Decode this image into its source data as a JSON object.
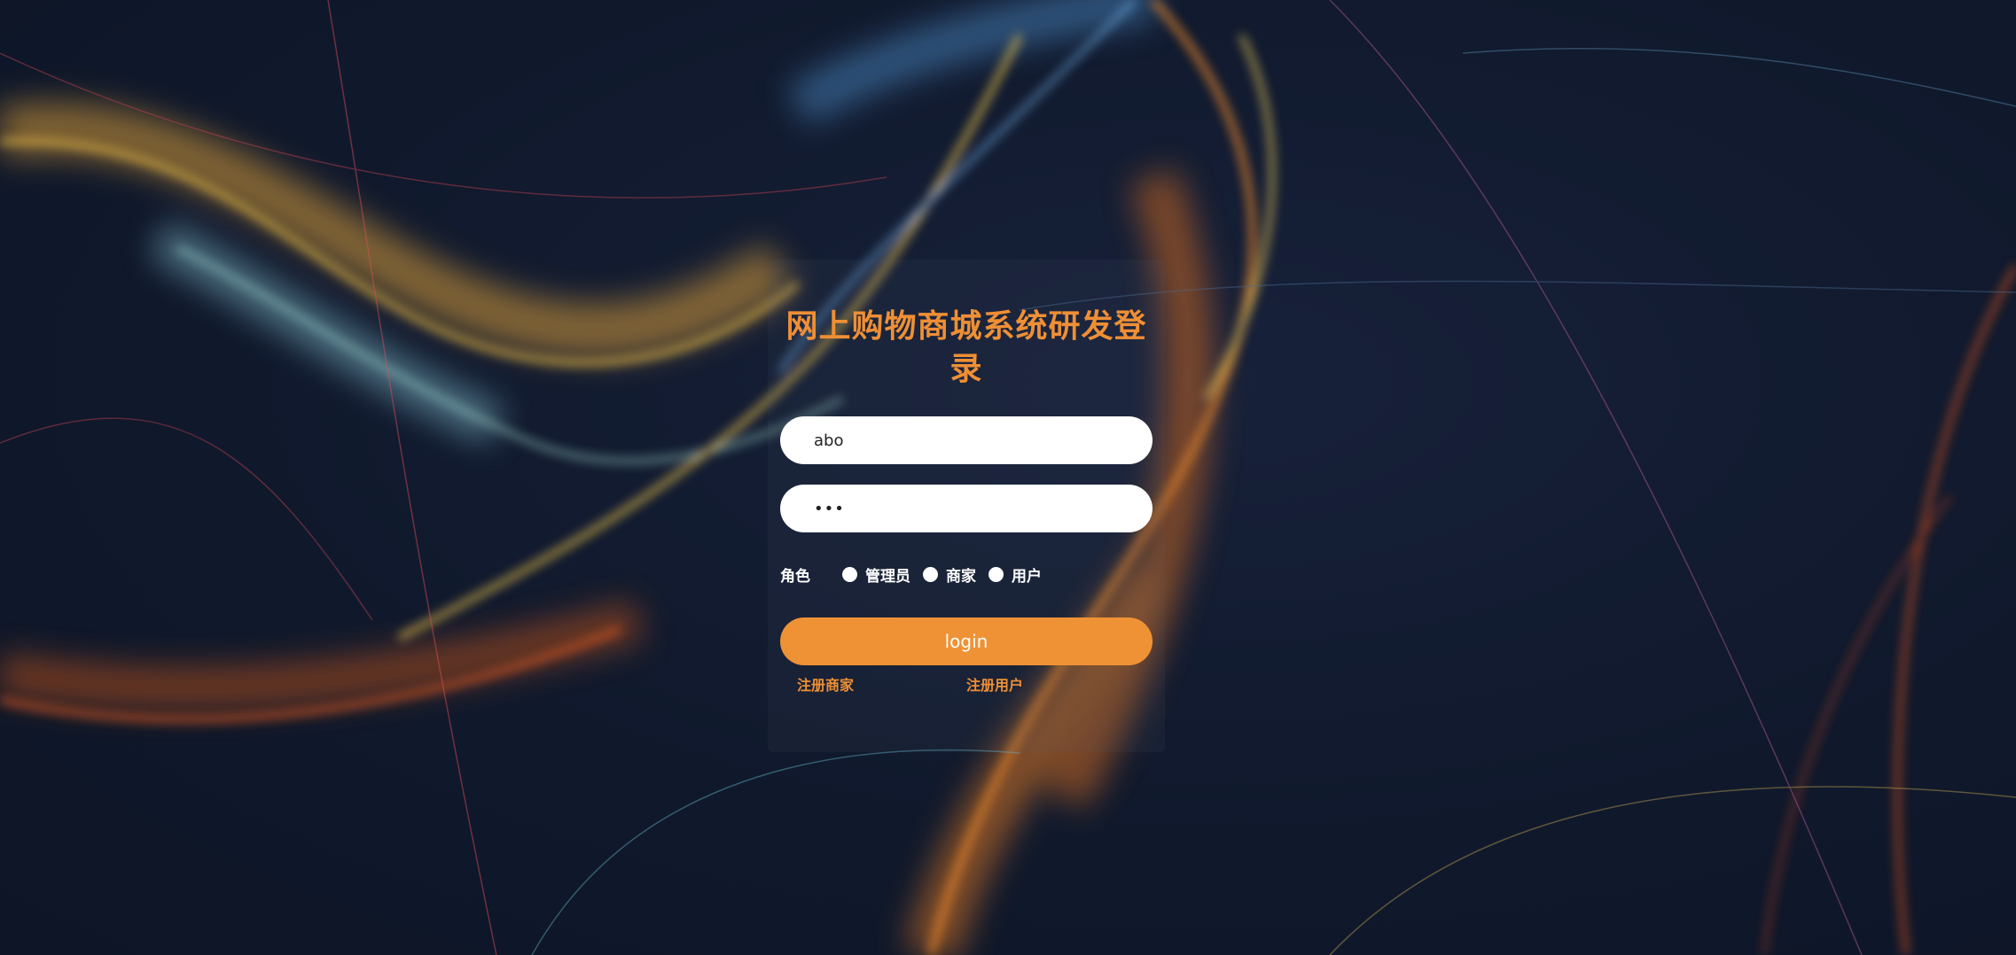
{
  "login": {
    "title": "网上购物商城系统研发登录",
    "username_value": "abo",
    "password_value": "•••",
    "role_label": "角色",
    "roles": [
      "管理员",
      "商家",
      "用户"
    ],
    "login_label": "login",
    "register_merchant": "注册商家",
    "register_user": "注册用户"
  },
  "colors": {
    "accent": "#ef9235",
    "background": "#111a2e",
    "field": "#ffffff"
  }
}
